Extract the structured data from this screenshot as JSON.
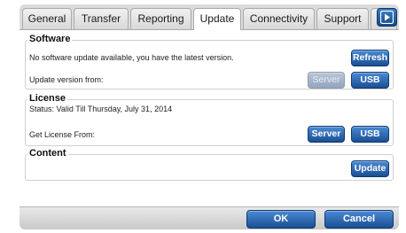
{
  "tabs": [
    {
      "label": "General"
    },
    {
      "label": "Transfer"
    },
    {
      "label": "Reporting"
    },
    {
      "label": "Update",
      "active": true
    },
    {
      "label": "Connectivity"
    },
    {
      "label": "Support"
    }
  ],
  "tab_scroll_icon": "play-arrow-icon",
  "software": {
    "title": "Software",
    "status": "No software update available, you have the latest version.",
    "refresh_label": "Refresh",
    "update_from_label": "Update version from:",
    "server_label": "Server",
    "server_enabled": false,
    "usb_label": "USB"
  },
  "license": {
    "title": "License",
    "status": "Status:  Valid  Till  Thursday, July 31, 2014",
    "get_from_label": "Get License From:",
    "server_label": "Server",
    "usb_label": "USB"
  },
  "content": {
    "title": "Content",
    "update_label": "Update"
  },
  "footer": {
    "ok_label": "OK",
    "cancel_label": "Cancel"
  },
  "colors": {
    "button_blue": "#1b4f93",
    "button_disabled": "#93a6bd",
    "tab_arrow": "#15498a"
  }
}
